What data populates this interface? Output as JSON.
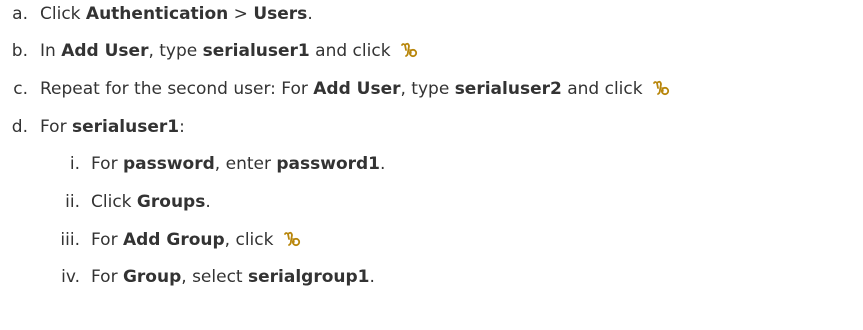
{
  "steps": [
    {
      "marker": "a.",
      "t1": "Click ",
      "b1": "Authentication",
      "t2": " > ",
      "b2": "Users",
      "t3": "."
    },
    {
      "marker": "b.",
      "t1": "In ",
      "b1": "Add User",
      "t2": ", type ",
      "b2": "serialuser1",
      "t3": " and click "
    },
    {
      "marker": "c.",
      "t1": "Repeat for the second user: For ",
      "b1": "Add User",
      "t2": ", type ",
      "b2": "serialuser2",
      "t3": " and click "
    },
    {
      "marker": "d.",
      "t1": "For ",
      "b1": "serialuser1",
      "t2": ":"
    }
  ],
  "substeps": [
    {
      "marker": "i.",
      "t1": "For ",
      "b1": "password",
      "t2": ", enter ",
      "b2": "password1",
      "t3": "."
    },
    {
      "marker": "ii.",
      "t1": "Click ",
      "b1": "Groups",
      "t2": "."
    },
    {
      "marker": "iii.",
      "t1": "For ",
      "b1": "Add Group",
      "t2": ", click "
    },
    {
      "marker": "iv.",
      "t1": "For ",
      "b1": "Group",
      "t2": ", select ",
      "b2": "serialgroup1",
      "t3": "."
    }
  ],
  "icons": {
    "add": "add-icon",
    "color": "#b8860b"
  }
}
